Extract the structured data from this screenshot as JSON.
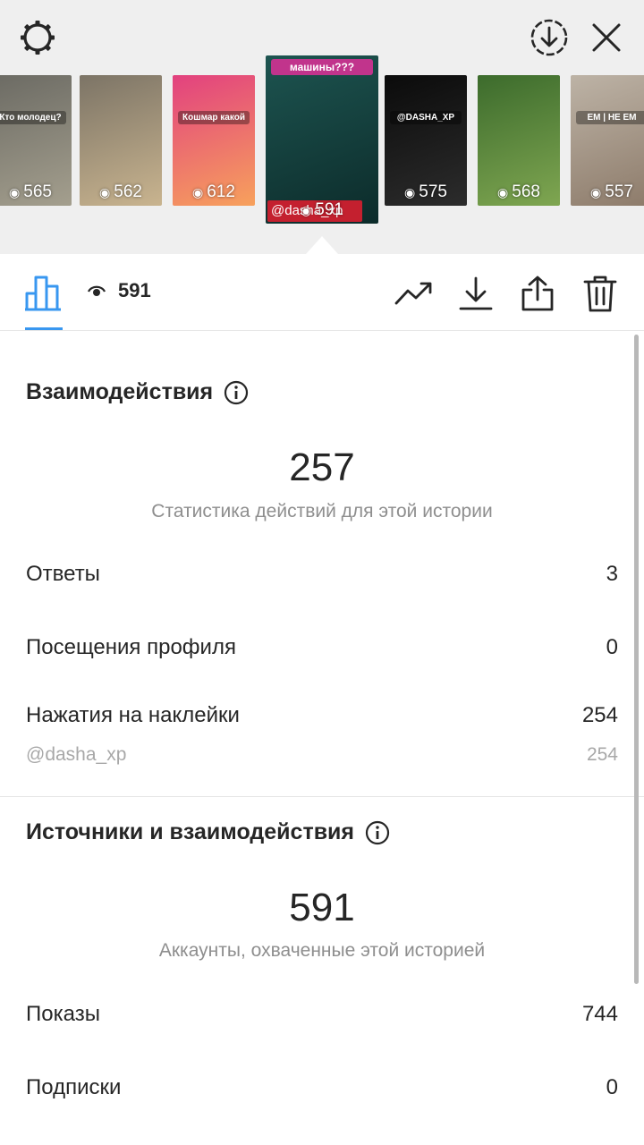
{
  "header": {
    "settings_icon": "gear-icon",
    "save_icon": "download-circle-icon",
    "close_icon": "close-icon"
  },
  "thumbnails": [
    {
      "views": "565",
      "colors": [
        "#6b6a63",
        "#a49f8e"
      ],
      "text": "Кто молодец?"
    },
    {
      "views": "562",
      "colors": [
        "#7c7466",
        "#c9b48f"
      ],
      "text": ""
    },
    {
      "views": "612",
      "colors": [
        "#e2417f",
        "#f7a15c"
      ],
      "text": "Кошмар какой"
    },
    {
      "views": "591",
      "colors": [
        "#1d5450",
        "#0c2b2a"
      ],
      "text": "машины???",
      "active": true,
      "tag": "@dasha_xp"
    },
    {
      "views": "575",
      "colors": [
        "#0b0b0b",
        "#2c2c2c"
      ],
      "text": "@DASHA_XP"
    },
    {
      "views": "568",
      "colors": [
        "#3c6b2c",
        "#7fa651"
      ],
      "text": ""
    },
    {
      "views": "557",
      "colors": [
        "#bdb3a6",
        "#8d7b6a"
      ],
      "text": "ЕМ | НЕ ЕМ"
    }
  ],
  "toolbar": {
    "views_count": "591",
    "icons": [
      "bar-chart-icon",
      "eye-icon",
      "trending-icon",
      "download-icon",
      "share-icon",
      "trash-icon"
    ]
  },
  "interactions": {
    "title": "Взаимодействия",
    "total": "257",
    "caption": "Статистика действий для этой истории",
    "rows": [
      {
        "label": "Ответы",
        "value": "3"
      },
      {
        "label": "Посещения профиля",
        "value": "0"
      },
      {
        "label": "Нажатия на наклейки",
        "value": "254"
      }
    ],
    "sub_row": {
      "label": "@dasha_xp",
      "value": "254"
    }
  },
  "discovery": {
    "title": "Источники и взаимодействия",
    "total": "591",
    "caption": "Аккаунты, охваченные этой историей",
    "rows": [
      {
        "label": "Показы",
        "value": "744"
      },
      {
        "label": "Подписки",
        "value": "0"
      }
    ]
  },
  "colors": {
    "accent": "#3897f0",
    "text": "#262626",
    "muted": "#8e8e8e"
  }
}
